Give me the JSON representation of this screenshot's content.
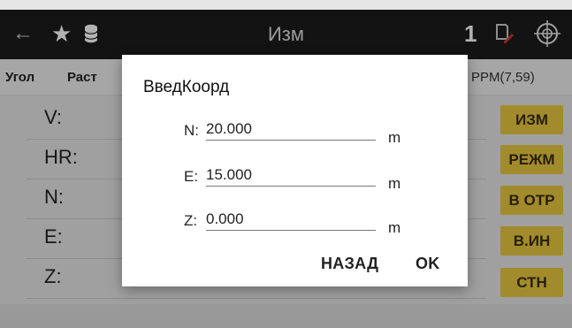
{
  "header": {
    "back_icon": "back-arrow-icon",
    "star_icon": "star-icon",
    "database_icon": "database-icon",
    "title": "Изм",
    "counter": "1",
    "edit_icon": "edit-document-icon",
    "target_icon": "crosshair-target-icon"
  },
  "tabs": {
    "items": [
      "Угол",
      "Раст"
    ],
    "ppm": "PPM(7,59)"
  },
  "measurements": {
    "rows": [
      "V:",
      "HR:",
      "N:",
      "E:",
      "Z:"
    ]
  },
  "side_buttons": [
    "ИЗМ",
    "РЕЖМ",
    "В ОТР",
    "В.ИН",
    "СТН"
  ],
  "dialog": {
    "title": "ВведКоорд",
    "fields": [
      {
        "label": "N:",
        "value": "20.000",
        "unit": "m"
      },
      {
        "label": "E:",
        "value": "15.000",
        "unit": "m"
      },
      {
        "label": "Z:",
        "value": "0.000",
        "unit": "m"
      }
    ],
    "back_label": "НАЗАД",
    "ok_label": "OK"
  },
  "colors": {
    "header_bg": "#1c1c1c",
    "button_yellow": "#e8c840",
    "edit_red": "#d9342b"
  }
}
